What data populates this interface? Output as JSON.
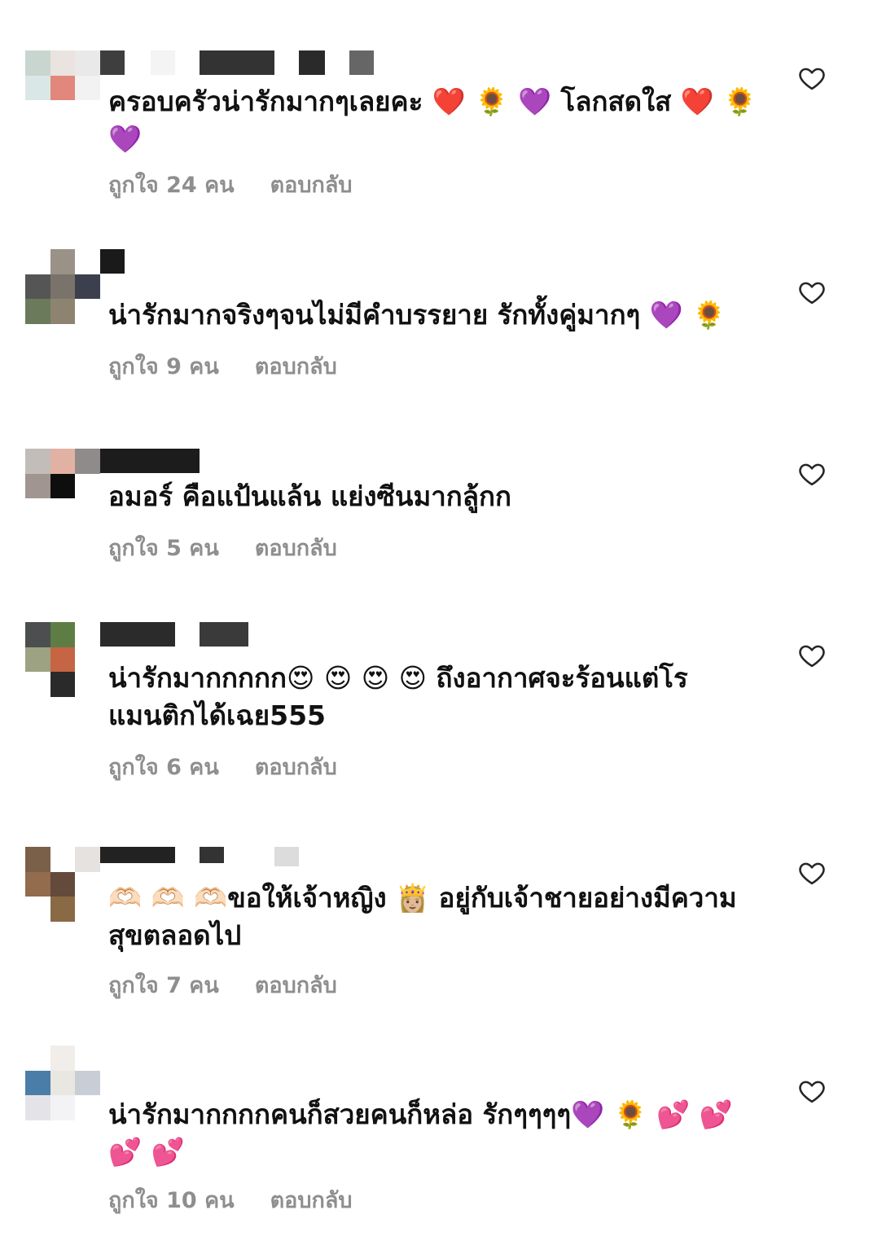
{
  "comments": [
    {
      "text": "ครอบครัวน่ารักมากๆเลยคะ ❤️ 🌻 💜 โลกสดใส ❤️ 🌻 💜",
      "likes_label": "ถูกใจ 24 คน",
      "reply_label": "ตอบกลับ",
      "avatar_colors": [
        "#c8d6cf",
        "#eae3df",
        "#e9e9e9",
        "#d9e8e6",
        "#e2877c",
        "#f2f2f2",
        "#ffffff",
        "#ffffff",
        "#ffffff"
      ]
    },
    {
      "text": "น่ารักมากจริงๆจนไม่มีคำบรรยาย รักทั้งคู่มากๆ 💜 🌻",
      "likes_label": "ถูกใจ 9 คน",
      "reply_label": "ตอบกลับ",
      "avatar_colors": [
        "#ffffff",
        "#9a9287",
        "#ffffff",
        "#555555",
        "#7a736b",
        "#3c3f4e",
        "#6b7a5a",
        "#8c8470",
        "#ffffff"
      ]
    },
    {
      "text": "อมอร์ คือแป้นแล้น แย่งซีนมากลู้กก",
      "likes_label": "ถูกใจ 5 คน",
      "reply_label": "ตอบกลับ",
      "avatar_colors": [
        "#c3bdb9",
        "#e1b2a3",
        "#8f8b8a",
        "#a09590",
        "#0e0e0e",
        "#ffffff",
        "#ffffff",
        "#ffffff",
        "#ffffff"
      ]
    },
    {
      "text": "น่ารักมากกกกก😍 😍 😍 😍 ถึงอากาศจะร้อนแต่โรแมนติกได้เฉย555",
      "likes_label": "ถูกใจ 6 คน",
      "reply_label": "ตอบกลับ",
      "avatar_colors": [
        "#4c4e4f",
        "#5e7d45",
        "#ffffff",
        "#9da283",
        "#c56544",
        "#ffffff",
        "#ffffff",
        "#2a2a2a",
        "#ffffff"
      ]
    },
    {
      "text": "🫶🏻 🫶🏻 🫶🏻ขอให้เจ้าหญิง 👸🏼 อยู่กับเจ้าชายอย่างมีความสุขตลอดไป",
      "likes_label": "ถูกใจ 7 คน",
      "reply_label": "ตอบกลับ",
      "avatar_colors": [
        "#7a6048",
        "#ffffff",
        "#e5e2df",
        "#936b4d",
        "#634a3a",
        "#ffffff",
        "#ffffff",
        "#8a6a45",
        "#ffffff"
      ]
    },
    {
      "text": "น่ารักมากกกกคนก็สวยคนก็หล่อ รักๆๆๆๆ💜 🌻 💕 💕 💕 💕",
      "likes_label": "ถูกใจ 10 คน",
      "reply_label": "ตอบกลับ",
      "avatar_colors": [
        "#ffffff",
        "#f1eeea",
        "#ffffff",
        "#4a7ea8",
        "#e9e7e1",
        "#c9ced6",
        "#e4e4e8",
        "#f3f3f5",
        "#ffffff"
      ]
    }
  ],
  "icons": {
    "like": "heart-outline-icon"
  },
  "colors": {
    "text": "#111111",
    "meta": "#8e8e8e",
    "heart": "#262626"
  }
}
